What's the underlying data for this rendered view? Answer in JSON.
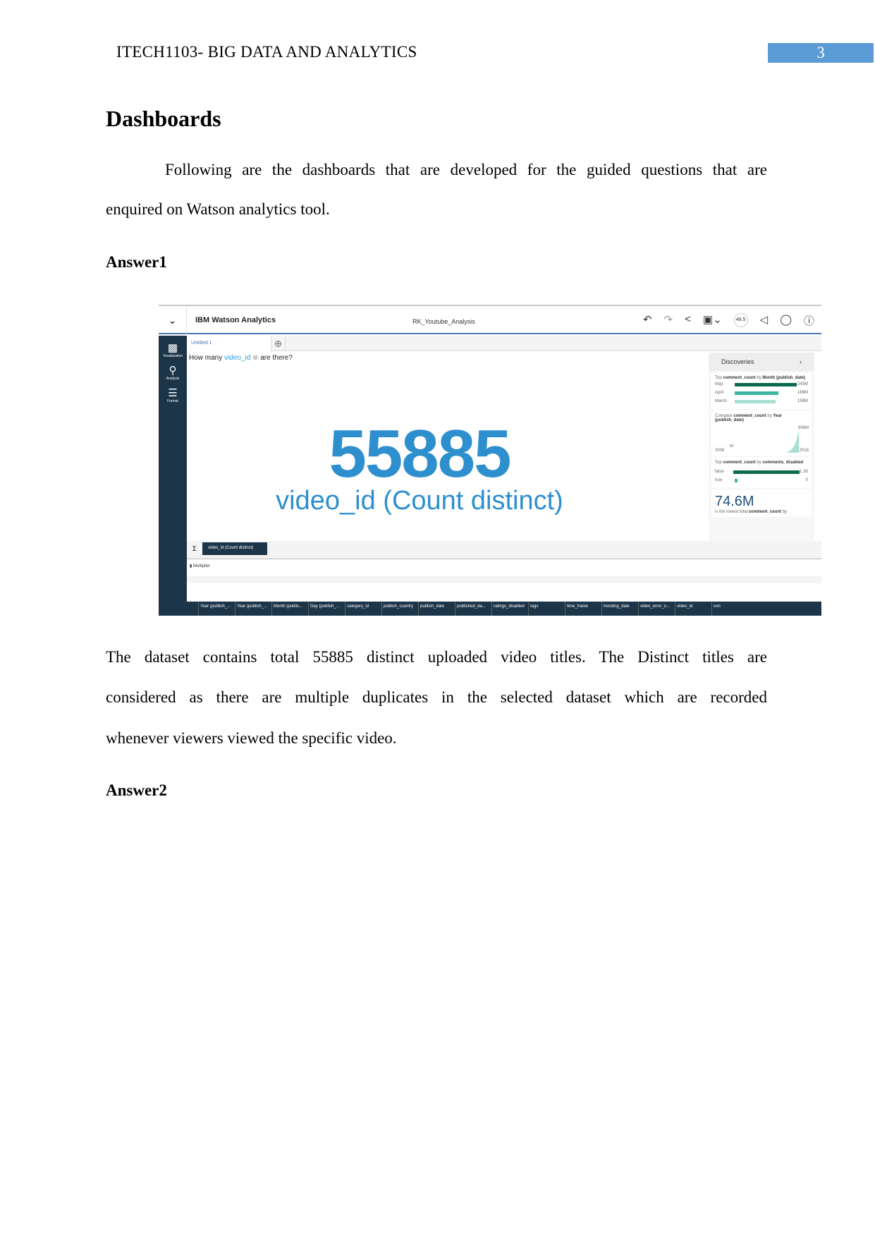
{
  "header": {
    "title": "ITECH1103- BIG DATA AND ANALYTICS",
    "page_number": "3"
  },
  "heading": "Dashboards",
  "intro": [
    "Following are the dashboards that are developed for the guided questions that are",
    "enquired on Watson analytics tool."
  ],
  "answer1": "Answer1",
  "screenshot": {
    "app_name": "IBM Watson Analytics",
    "project": "RK_Youtube_Analysis",
    "usage": "48.5",
    "sidebar": [
      "Visualization",
      "Analysis",
      "Format"
    ],
    "tab": "Untitled 1",
    "question": {
      "pre": "How many",
      "field": "video_id",
      "post": "are there?"
    },
    "value": "55885",
    "value_label": "video_id (Count distinct)",
    "discoveries": {
      "title": "Discoveries",
      "card1": {
        "pre": "Top",
        "measure": "comment_count",
        "by": "by",
        "dim": "Month (publish_date)",
        "rows": [
          {
            "k": "May",
            "v": "243M",
            "pct": 100
          },
          {
            "k": "April",
            "v": "169M",
            "pct": 70
          },
          {
            "k": "March",
            "v": "159M",
            "pct": 65
          }
        ]
      },
      "card2": {
        "pre": "Compare",
        "measure": "comment_count",
        "by": "by",
        "dim": "Year (publish_date)",
        "start": "2006",
        "start_val": "82",
        "end": "2018",
        "end_val": "906M"
      },
      "card3": {
        "pre": "Top",
        "measure": "comment_count",
        "by": "by",
        "dim": "comments_disabled",
        "rows": [
          {
            "k": "false",
            "v": "1.1B",
            "pct": 100
          },
          {
            "k": "true",
            "v": "0",
            "pct": 2
          }
        ]
      },
      "card4": {
        "value": "74.6M",
        "text": "is the lowest total",
        "measure": "comment_count",
        "by": "by"
      }
    },
    "pill": "video_id (Count distinct)",
    "multiplier": "Multiplier",
    "columns": [
      "Year (publish_...",
      "Year (publish_...",
      "Month (publis...",
      "Day (publish_...",
      "category_id",
      "publish_country",
      "publish_date",
      "published_da...",
      "ratings_disabled",
      "tags",
      "time_frame",
      "trending_date",
      "video_error_o...",
      "video_id",
      "con"
    ]
  },
  "body": [
    "The dataset contains total 55885 distinct uploaded video titles.  The Distinct titles are",
    "considered as there are multiple duplicates in the selected dataset which are recorded",
    "whenever viewers viewed the specific video."
  ],
  "answer2": "Answer2"
}
